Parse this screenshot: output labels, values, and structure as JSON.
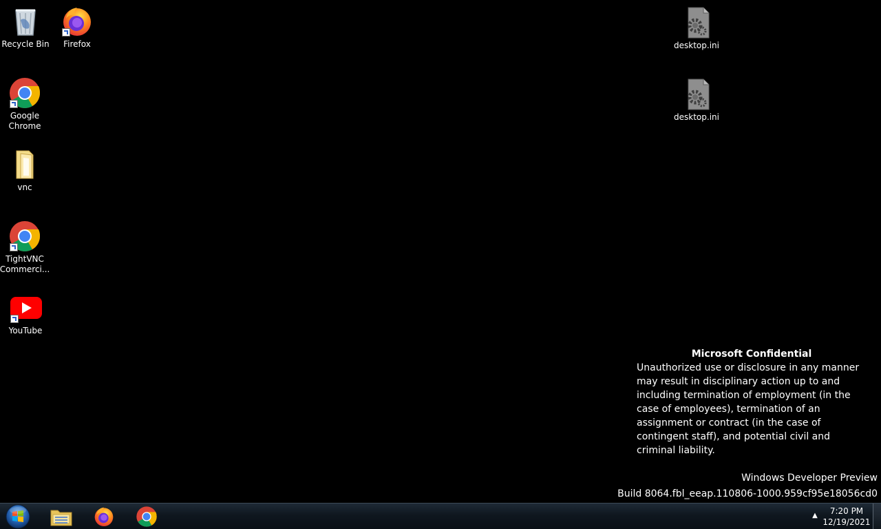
{
  "desktop_icons": [
    {
      "name": "recycle-bin",
      "label": "Recycle Bin",
      "icon": "recycle-bin-icon"
    },
    {
      "name": "firefox",
      "label": "Firefox",
      "icon": "firefox-icon"
    },
    {
      "name": "google-chrome",
      "label": "Google Chrome",
      "icon": "chrome-icon"
    },
    {
      "name": "vnc",
      "label": "vnc",
      "icon": "folder-icon"
    },
    {
      "name": "tightvnc",
      "label": "TightVNC Commerci...",
      "icon": "chrome-icon"
    },
    {
      "name": "youtube",
      "label": "YouTube",
      "icon": "youtube-icon"
    },
    {
      "name": "desktop-ini-1",
      "label": "desktop.ini",
      "icon": "settings-file-icon"
    },
    {
      "name": "desktop-ini-2",
      "label": "desktop.ini",
      "icon": "settings-file-icon"
    }
  ],
  "watermark": {
    "title": "Microsoft Confidential",
    "body": "Unauthorized use or disclosure in any manner may result in disciplinary action up to and including termination of employment (in the case of employees), termination of an assignment or contract (in the case of contingent staff), and potential civil and criminal liability."
  },
  "build": {
    "line1": "Windows Developer Preview",
    "line2": "Build 8064.fbl_eeap.110806-1000.959cf95e18056cd0"
  },
  "taskbar": {
    "start_icon": "windows-logo-icon",
    "pinned": [
      {
        "name": "file-explorer",
        "icon": "file-explorer-icon"
      },
      {
        "name": "firefox",
        "icon": "firefox-icon"
      },
      {
        "name": "chrome",
        "icon": "chrome-icon"
      }
    ],
    "tray_arrow": "▲",
    "clock_time": "7:20 PM",
    "clock_date": "12/19/2021"
  },
  "colors": {
    "desktop_bg": "#000000",
    "taskbar_bg": "#0f171f",
    "text": "#ffffff"
  }
}
